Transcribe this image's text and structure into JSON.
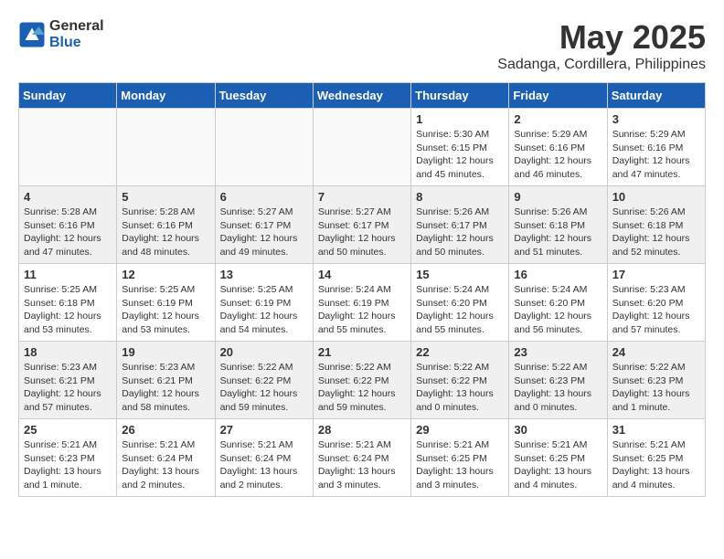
{
  "logo": {
    "general": "General",
    "blue": "Blue"
  },
  "header": {
    "month_year": "May 2025",
    "location": "Sadanga, Cordillera, Philippines"
  },
  "weekdays": [
    "Sunday",
    "Monday",
    "Tuesday",
    "Wednesday",
    "Thursday",
    "Friday",
    "Saturday"
  ],
  "weeks": [
    [
      {
        "day": "",
        "info": ""
      },
      {
        "day": "",
        "info": ""
      },
      {
        "day": "",
        "info": ""
      },
      {
        "day": "",
        "info": ""
      },
      {
        "day": "1",
        "info": "Sunrise: 5:30 AM\nSunset: 6:15 PM\nDaylight: 12 hours\nand 45 minutes."
      },
      {
        "day": "2",
        "info": "Sunrise: 5:29 AM\nSunset: 6:16 PM\nDaylight: 12 hours\nand 46 minutes."
      },
      {
        "day": "3",
        "info": "Sunrise: 5:29 AM\nSunset: 6:16 PM\nDaylight: 12 hours\nand 47 minutes."
      }
    ],
    [
      {
        "day": "4",
        "info": "Sunrise: 5:28 AM\nSunset: 6:16 PM\nDaylight: 12 hours\nand 47 minutes."
      },
      {
        "day": "5",
        "info": "Sunrise: 5:28 AM\nSunset: 6:16 PM\nDaylight: 12 hours\nand 48 minutes."
      },
      {
        "day": "6",
        "info": "Sunrise: 5:27 AM\nSunset: 6:17 PM\nDaylight: 12 hours\nand 49 minutes."
      },
      {
        "day": "7",
        "info": "Sunrise: 5:27 AM\nSunset: 6:17 PM\nDaylight: 12 hours\nand 50 minutes."
      },
      {
        "day": "8",
        "info": "Sunrise: 5:26 AM\nSunset: 6:17 PM\nDaylight: 12 hours\nand 50 minutes."
      },
      {
        "day": "9",
        "info": "Sunrise: 5:26 AM\nSunset: 6:18 PM\nDaylight: 12 hours\nand 51 minutes."
      },
      {
        "day": "10",
        "info": "Sunrise: 5:26 AM\nSunset: 6:18 PM\nDaylight: 12 hours\nand 52 minutes."
      }
    ],
    [
      {
        "day": "11",
        "info": "Sunrise: 5:25 AM\nSunset: 6:18 PM\nDaylight: 12 hours\nand 53 minutes."
      },
      {
        "day": "12",
        "info": "Sunrise: 5:25 AM\nSunset: 6:19 PM\nDaylight: 12 hours\nand 53 minutes."
      },
      {
        "day": "13",
        "info": "Sunrise: 5:25 AM\nSunset: 6:19 PM\nDaylight: 12 hours\nand 54 minutes."
      },
      {
        "day": "14",
        "info": "Sunrise: 5:24 AM\nSunset: 6:19 PM\nDaylight: 12 hours\nand 55 minutes."
      },
      {
        "day": "15",
        "info": "Sunrise: 5:24 AM\nSunset: 6:20 PM\nDaylight: 12 hours\nand 55 minutes."
      },
      {
        "day": "16",
        "info": "Sunrise: 5:24 AM\nSunset: 6:20 PM\nDaylight: 12 hours\nand 56 minutes."
      },
      {
        "day": "17",
        "info": "Sunrise: 5:23 AM\nSunset: 6:20 PM\nDaylight: 12 hours\nand 57 minutes."
      }
    ],
    [
      {
        "day": "18",
        "info": "Sunrise: 5:23 AM\nSunset: 6:21 PM\nDaylight: 12 hours\nand 57 minutes."
      },
      {
        "day": "19",
        "info": "Sunrise: 5:23 AM\nSunset: 6:21 PM\nDaylight: 12 hours\nand 58 minutes."
      },
      {
        "day": "20",
        "info": "Sunrise: 5:22 AM\nSunset: 6:22 PM\nDaylight: 12 hours\nand 59 minutes."
      },
      {
        "day": "21",
        "info": "Sunrise: 5:22 AM\nSunset: 6:22 PM\nDaylight: 12 hours\nand 59 minutes."
      },
      {
        "day": "22",
        "info": "Sunrise: 5:22 AM\nSunset: 6:22 PM\nDaylight: 13 hours\nand 0 minutes."
      },
      {
        "day": "23",
        "info": "Sunrise: 5:22 AM\nSunset: 6:23 PM\nDaylight: 13 hours\nand 0 minutes."
      },
      {
        "day": "24",
        "info": "Sunrise: 5:22 AM\nSunset: 6:23 PM\nDaylight: 13 hours\nand 1 minute."
      }
    ],
    [
      {
        "day": "25",
        "info": "Sunrise: 5:21 AM\nSunset: 6:23 PM\nDaylight: 13 hours\nand 1 minute."
      },
      {
        "day": "26",
        "info": "Sunrise: 5:21 AM\nSunset: 6:24 PM\nDaylight: 13 hours\nand 2 minutes."
      },
      {
        "day": "27",
        "info": "Sunrise: 5:21 AM\nSunset: 6:24 PM\nDaylight: 13 hours\nand 2 minutes."
      },
      {
        "day": "28",
        "info": "Sunrise: 5:21 AM\nSunset: 6:24 PM\nDaylight: 13 hours\nand 3 minutes."
      },
      {
        "day": "29",
        "info": "Sunrise: 5:21 AM\nSunset: 6:25 PM\nDaylight: 13 hours\nand 3 minutes."
      },
      {
        "day": "30",
        "info": "Sunrise: 5:21 AM\nSunset: 6:25 PM\nDaylight: 13 hours\nand 4 minutes."
      },
      {
        "day": "31",
        "info": "Sunrise: 5:21 AM\nSunset: 6:25 PM\nDaylight: 13 hours\nand 4 minutes."
      }
    ]
  ]
}
